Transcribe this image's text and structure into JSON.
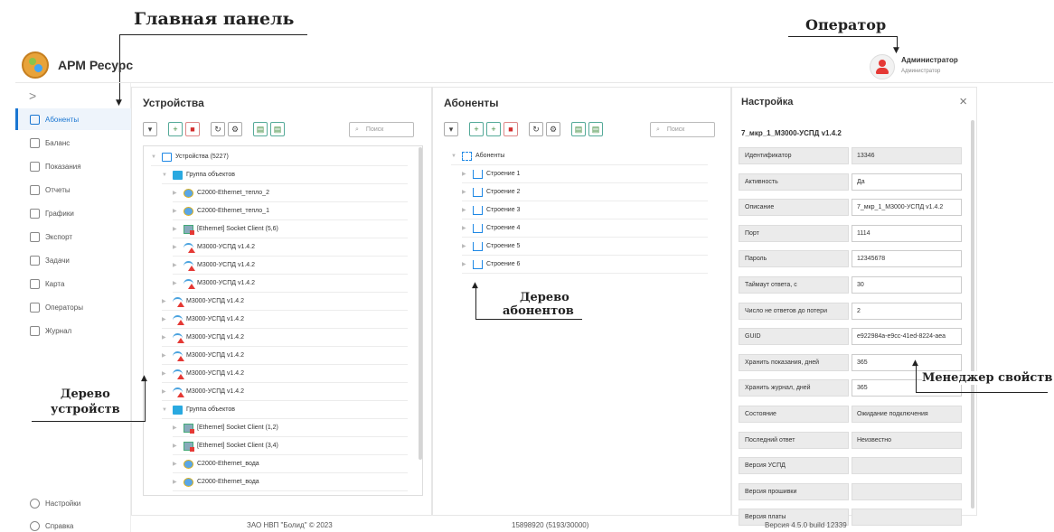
{
  "annotations": {
    "main_panel": "Главная панель",
    "operator": "Оператор",
    "device_tree": [
      "Дерево",
      "устройств"
    ],
    "subscriber_tree": [
      "Дерево",
      "абонентов"
    ],
    "property_manager": "Менеджер свойств"
  },
  "header": {
    "app_title": "АРМ Ресурс",
    "user_name": "Администратор",
    "user_role": "Администратор"
  },
  "sidebar": {
    "collapse_glyph": ">",
    "items": [
      {
        "label": "Абоненты",
        "icon": "home-icon",
        "active": true
      },
      {
        "label": "Баланс",
        "icon": "balance-icon"
      },
      {
        "label": "Показания",
        "icon": "readings-icon"
      },
      {
        "label": "Отчеты",
        "icon": "table-icon"
      },
      {
        "label": "Графики",
        "icon": "chart-icon"
      },
      {
        "label": "Экспорт",
        "icon": "upload-icon"
      },
      {
        "label": "Задачи",
        "icon": "tasks-icon"
      },
      {
        "label": "Карта",
        "icon": "map-pin-icon"
      },
      {
        "label": "Операторы",
        "icon": "user-icon"
      },
      {
        "label": "Журнал",
        "icon": "journal-icon"
      }
    ],
    "bottom_items": [
      {
        "label": "Настройки",
        "icon": "gear-icon"
      },
      {
        "label": "Справка",
        "icon": "help-icon"
      }
    ]
  },
  "devices": {
    "title": "Устройства",
    "search_placeholder": "Поиск",
    "tree": [
      {
        "label": "Устройства (5227)",
        "icon": "device-icon",
        "level": 0,
        "expanded": true
      },
      {
        "label": "Группа объектов",
        "icon": "folder-icon",
        "level": 1,
        "expanded": true
      },
      {
        "label": "C2000-Ethernet_тепло_2",
        "icon": "globe-icon",
        "level": 2
      },
      {
        "label": "C2000-Ethernet_тепло_1",
        "icon": "globe-icon",
        "level": 2
      },
      {
        "label": "[Ethernet] Socket Client (5,6)",
        "icon": "socket-icon",
        "level": 2
      },
      {
        "label": "M3000-УСПД v1.4.2",
        "icon": "wifi-alert-icon",
        "level": 2
      },
      {
        "label": "M3000-УСПД v1.4.2",
        "icon": "wifi-alert-icon",
        "level": 2
      },
      {
        "label": "M3000-УСПД v1.4.2",
        "icon": "wifi-alert-icon",
        "level": 2
      },
      {
        "label": "M3000-УСПД v1.4.2",
        "icon": "wifi-alert-icon",
        "level": 1
      },
      {
        "label": "M3000-УСПД v1.4.2",
        "icon": "wifi-alert-icon",
        "level": 1
      },
      {
        "label": "M3000-УСПД v1.4.2",
        "icon": "wifi-alert-icon",
        "level": 1
      },
      {
        "label": "M3000-УСПД v1.4.2",
        "icon": "wifi-alert-icon",
        "level": 1
      },
      {
        "label": "M3000-УСПД v1.4.2",
        "icon": "wifi-alert-icon",
        "level": 1
      },
      {
        "label": "M3000-УСПД v1.4.2",
        "icon": "wifi-alert-icon",
        "level": 1
      },
      {
        "label": "Группа объектов",
        "icon": "folder-icon",
        "level": 1,
        "expanded": true
      },
      {
        "label": "[Ethernet] Socket Client (1,2)",
        "icon": "socket-icon",
        "level": 2
      },
      {
        "label": "[Ethernet] Socket Client (3,4)",
        "icon": "socket-icon",
        "level": 2
      },
      {
        "label": "C2000-Ethernet_вода",
        "icon": "globe-icon",
        "level": 2
      },
      {
        "label": "C2000-Ethernet_вода",
        "icon": "globe-icon",
        "level": 2
      }
    ]
  },
  "subscribers": {
    "title": "Абоненты",
    "search_placeholder": "Поиск",
    "tree": [
      {
        "label": "Абоненты",
        "icon": "subscribers-icon",
        "level": 0,
        "expanded": true
      },
      {
        "label": "Строение 1",
        "icon": "house-icon",
        "level": 1
      },
      {
        "label": "Строение 2",
        "icon": "house-icon",
        "level": 1
      },
      {
        "label": "Строение 3",
        "icon": "house-icon",
        "level": 1
      },
      {
        "label": "Строение 4",
        "icon": "house-icon",
        "level": 1
      },
      {
        "label": "Строение 5",
        "icon": "house-icon",
        "level": 1
      },
      {
        "label": "Строение 6",
        "icon": "house-icon",
        "level": 1
      }
    ]
  },
  "settings": {
    "title": "Настройка",
    "close_glyph": "×",
    "object_name": "7_мкр_1_М3000-УСПД v1.4.2",
    "properties": [
      {
        "label": "Идентификатор",
        "value": "13346",
        "readonly": true
      },
      {
        "label": "Активность",
        "value": "Да",
        "readonly": false
      },
      {
        "label": "Описание",
        "value": "7_мкр_1_М3000-УСПД v1.4.2",
        "readonly": false
      },
      {
        "label": "Порт",
        "value": "1114",
        "readonly": false
      },
      {
        "label": "Пароль",
        "value": "12345678",
        "readonly": false
      },
      {
        "label": "Таймаут ответа, с",
        "value": "30",
        "readonly": false
      },
      {
        "label": "Число не ответов до потери",
        "value": "2",
        "readonly": false
      },
      {
        "label": "GUID",
        "value": "e922984a-e9cc-41ed-8224-aea",
        "readonly": false
      },
      {
        "label": "Хранить показания, дней",
        "value": "365",
        "readonly": false
      },
      {
        "label": "Хранить журнал, дней",
        "value": "365",
        "readonly": false
      },
      {
        "label": "Состояние",
        "value": "Ожидание подключения",
        "readonly": true
      },
      {
        "label": "Последний ответ",
        "value": "Неизвестно",
        "readonly": true
      },
      {
        "label": "Версия УСПД",
        "value": "",
        "readonly": true
      },
      {
        "label": "Версия прошивки",
        "value": "",
        "readonly": true
      },
      {
        "label": "Версия платы",
        "value": "",
        "readonly": true
      }
    ]
  },
  "footer": {
    "company": "ЗАО НВП \"Болид\" © 2023",
    "counts": "15898920 (5193/30000)",
    "version": "Версия 4.5.0 build 12339"
  }
}
